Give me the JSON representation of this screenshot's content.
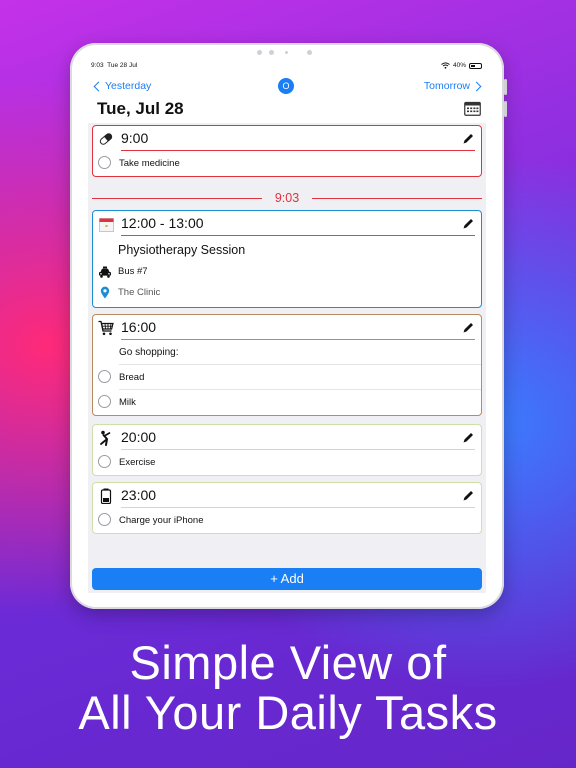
{
  "status": {
    "time": "9:03",
    "date": "Tue 28 Jul",
    "battery": "40%"
  },
  "nav": {
    "back_label": "Yesterday",
    "forward_label": "Tomorrow",
    "center_badge": "O"
  },
  "header": {
    "title": "Tue, Jul 28"
  },
  "now_line": {
    "time": "9:03",
    "color": "#e0323c"
  },
  "tasks": [
    {
      "time": "9:00",
      "icon": "pill-icon",
      "color": "#e0323c",
      "items": [
        {
          "text": "Take medicine"
        }
      ]
    },
    {
      "time": "12:00 - 13:00",
      "icon": "calendar-icon",
      "color": "#1a8fd6",
      "title": "Physiotherapy Session",
      "details": [
        {
          "icon": "taxi-icon",
          "text": "Bus #7"
        },
        {
          "icon": "location-pin-icon",
          "text": "The Clinic"
        }
      ]
    },
    {
      "time": "16:00",
      "icon": "cart-icon",
      "color": "#b98a5e",
      "heading": "Go shopping:",
      "items": [
        {
          "text": "Bread"
        },
        {
          "text": "Milk"
        }
      ]
    },
    {
      "time": "20:00",
      "icon": "stretching-icon",
      "color": "#cde0a8",
      "items": [
        {
          "text": "Exercise"
        }
      ]
    },
    {
      "time": "23:00",
      "icon": "battery-icon",
      "color": "#cde0a8",
      "items": [
        {
          "text": "Charge your iPhone"
        }
      ]
    }
  ],
  "add_button": {
    "label": "+ Add",
    "color": "#1a7ef5"
  },
  "tagline": {
    "line1": "Simple View of",
    "line2": "All Your Daily Tasks"
  }
}
